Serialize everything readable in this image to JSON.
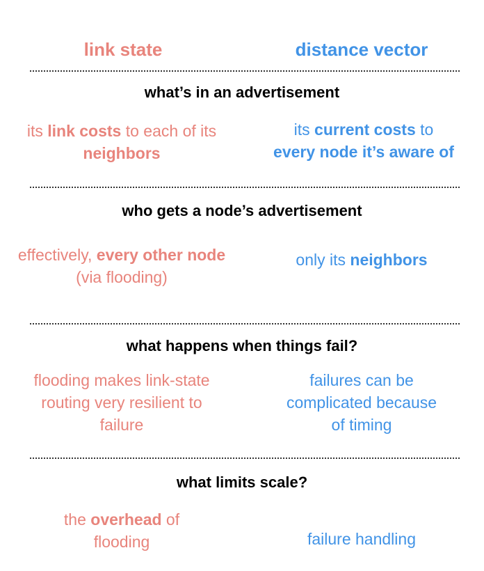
{
  "headers": {
    "left": "link state",
    "right": "distance vector",
    "left_color": "#e8847c",
    "right_color": "#4193e6"
  },
  "rows": [
    {
      "question": "what’s in an advertisement",
      "left": {
        "p1": "its ",
        "b1": "link costs",
        "p2": " to each of its ",
        "b2": "neighbors",
        "p3": ""
      },
      "right": {
        "p1": "its ",
        "b1": "current costs",
        "p2": " to ",
        "b2": "every node it’s aware of",
        "p3": ""
      }
    },
    {
      "question": "who gets a node’s advertisement",
      "left": {
        "p1": "effectively, ",
        "b1": "every other node",
        "p2": " (via flooding)"
      },
      "right": {
        "p1": "only its ",
        "b1": "neighbors"
      }
    },
    {
      "question": "what happens when things fail?",
      "left": {
        "text": "flooding makes link-state routing very resilient to failure"
      },
      "right": {
        "text": "failures can be complicated because of timing"
      }
    },
    {
      "question": "what limits scale?",
      "left": {
        "p1": "the ",
        "b1": "overhead",
        "p2": " of flooding"
      },
      "right": {
        "text": "failure handling"
      }
    }
  ]
}
